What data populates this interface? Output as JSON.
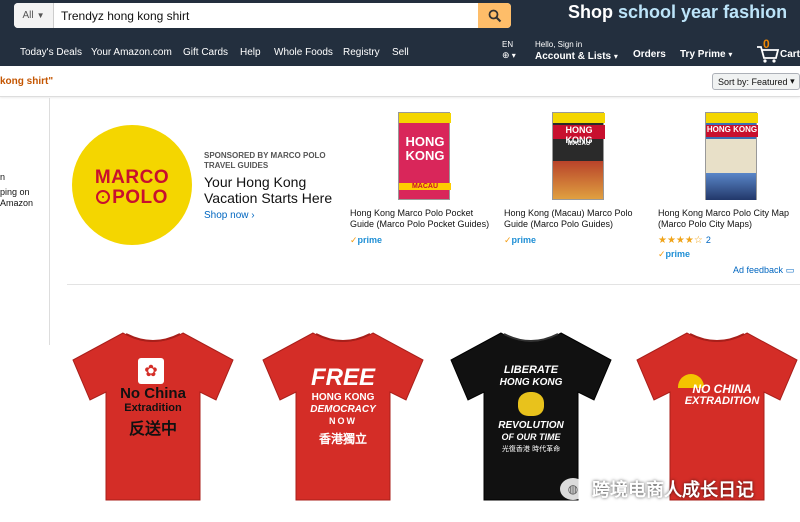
{
  "header": {
    "search_dept": "All",
    "search_value": "Trendyz hong kong shirt",
    "promo_part1": "Shop",
    "promo_part2": "school year fashion"
  },
  "nav": {
    "links": [
      "Today's Deals",
      "Your Amazon.com",
      "Gift Cards",
      "Help",
      "Whole Foods",
      "Registry",
      "Sell"
    ],
    "lang": "EN",
    "greeting": "Hello, Sign in",
    "account_lists": "Account & Lists",
    "orders": "Orders",
    "try_prime": "Try Prime",
    "cart_count": "0",
    "cart": "Cart"
  },
  "results": {
    "query_fragment": "kong shirt\"",
    "sort_label": "Sort by:",
    "sort_value": "Featured"
  },
  "left_panel": {
    "lines": [
      "n",
      "ping on",
      "Amazon"
    ]
  },
  "sponsored": {
    "brand_line1": "MARCO",
    "brand_line2": "POLO",
    "sponsored_by": "SPONSORED BY MARCO POLO TRAVEL GUIDES",
    "headline": "Your Hong Kong Vacation Starts Here",
    "cta": "Shop now ›",
    "products": [
      {
        "title": "Hong Kong Marco Polo Pocket Guide (Marco Polo Pocket Guides)",
        "prime": "prime",
        "cover_text": "HONG KONG",
        "cover_sub": "MACAU",
        "cover_color": "#d9265a"
      },
      {
        "title": "Hong Kong (Macau) Marco Polo Guide (Marco Polo Guides)",
        "prime": "prime",
        "cover_text": "HONG KONG",
        "cover_sub": "MACAU",
        "cover_color": "#b8432a"
      },
      {
        "title": "Hong Kong Marco Polo City Map (Marco Polo City Maps)",
        "prime": "prime",
        "cover_text": "HONG KONG",
        "cover_sub": "",
        "cover_color": "#c8102e",
        "rating": 3.5,
        "rating_count": "2"
      }
    ],
    "ad_feedback": "Ad feedback"
  },
  "shirts": [
    {
      "color": "#d42d27",
      "lines": [
        "No China",
        "Extradition",
        "反送中"
      ]
    },
    {
      "color": "#d42d27",
      "lines": [
        "FREE",
        "HONG KONG",
        "DEMOCRACY",
        "NOW",
        "香港獨立"
      ]
    },
    {
      "color": "#111111",
      "lines": [
        "LIBERATE",
        "HONG KONG",
        "REVOLUTION",
        "OF OUR TIME",
        "光復香港 時代革命"
      ]
    },
    {
      "color": "#d42d27",
      "lines": [
        "NO CHINA",
        "EXTRADITION"
      ]
    }
  ],
  "watermark": "跨境电商人成长日记",
  "colors": {
    "nav_bg": "#232f3e",
    "search_button": "#febd69",
    "link": "#0066c0",
    "prime": "#1f8fd5",
    "query": "#c45500"
  }
}
